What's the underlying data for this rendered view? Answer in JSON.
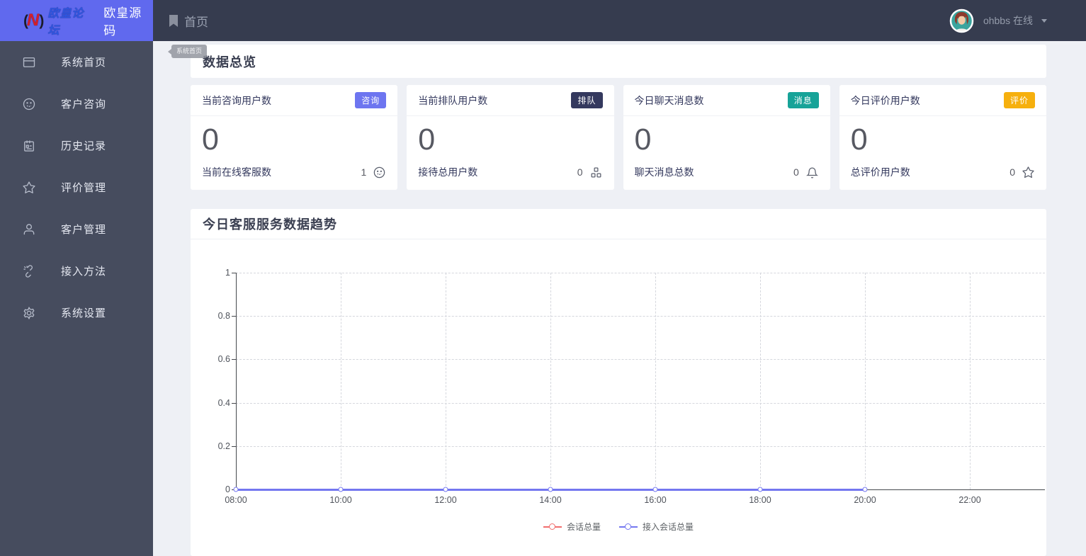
{
  "colors": {
    "primary": "#6069ee",
    "topbar_bg": "#363c4f",
    "sidebar_bg": "#464c5e",
    "badge_consult": "#6d75f0",
    "badge_queue": "#34395e",
    "badge_message": "#17a398",
    "badge_rating": "#f6b00e",
    "series_red": "#f16d6d",
    "series_purple": "#7477f0"
  },
  "brand": {
    "logo_left_paren": "(",
    "logo_letter": "N",
    "logo_right_paren": ")",
    "logo_sub": "欧皇论坛",
    "name": "欧皇源码"
  },
  "topbar": {
    "home": "首页",
    "user_name": "ohbbs",
    "user_status": "在线"
  },
  "tooltip": "系统首页",
  "sidebar": {
    "items": [
      {
        "label": "系统首页",
        "icon": "window-icon"
      },
      {
        "label": "客户咨询",
        "icon": "smiley-icon"
      },
      {
        "label": "历史记录",
        "icon": "notebook-icon"
      },
      {
        "label": "评价管理",
        "icon": "star-icon"
      },
      {
        "label": "客户管理",
        "icon": "user-icon"
      },
      {
        "label": "接入方法",
        "icon": "unlink-icon"
      },
      {
        "label": "系统设置",
        "icon": "gear-icon"
      }
    ]
  },
  "overview": {
    "title": "数据总览",
    "cards": [
      {
        "title": "当前咨询用户数",
        "badge": "咨询",
        "badge_color": "#6d75f0",
        "value": "0",
        "foot_label": "当前在线客服数",
        "foot_value": "1",
        "foot_icon": "service-smiley-icon"
      },
      {
        "title": "当前排队用户数",
        "badge": "排队",
        "badge_color": "#34395e",
        "value": "0",
        "foot_label": "接待总用户数",
        "foot_value": "0",
        "foot_icon": "group-grid-icon"
      },
      {
        "title": "今日聊天消息数",
        "badge": "消息",
        "badge_color": "#17a398",
        "value": "0",
        "foot_label": "聊天消息总数",
        "foot_value": "0",
        "foot_icon": "bell-icon"
      },
      {
        "title": "今日评价用户数",
        "badge": "评价",
        "badge_color": "#f6b00e",
        "value": "0",
        "foot_label": "总评价用户数",
        "foot_value": "0",
        "foot_icon": "star-icon"
      }
    ]
  },
  "chart": {
    "title": "今日客服服务数据趋势"
  },
  "chart_data": {
    "type": "line",
    "title": "今日客服服务数据趋势",
    "x_ticks": [
      "08:00",
      "10:00",
      "12:00",
      "14:00",
      "16:00",
      "18:00",
      "20:00",
      "22:00"
    ],
    "y_ticks": [
      "1",
      "0.8",
      "0.6",
      "0.4",
      "0.2",
      "0"
    ],
    "ylim": [
      0,
      1
    ],
    "grid": true,
    "legend_position": "bottom",
    "series": [
      {
        "name": "会话总量",
        "color": "#f16d6d",
        "x": [
          "08:00",
          "10:00",
          "12:00",
          "14:00",
          "16:00",
          "18:00",
          "20:00"
        ],
        "values": [
          0,
          0,
          0,
          0,
          0,
          0,
          0
        ]
      },
      {
        "name": "接入会话总量",
        "color": "#7477f0",
        "x": [
          "08:00",
          "10:00",
          "12:00",
          "14:00",
          "16:00",
          "18:00",
          "20:00"
        ],
        "values": [
          0,
          0,
          0,
          0,
          0,
          0,
          0
        ]
      }
    ]
  }
}
